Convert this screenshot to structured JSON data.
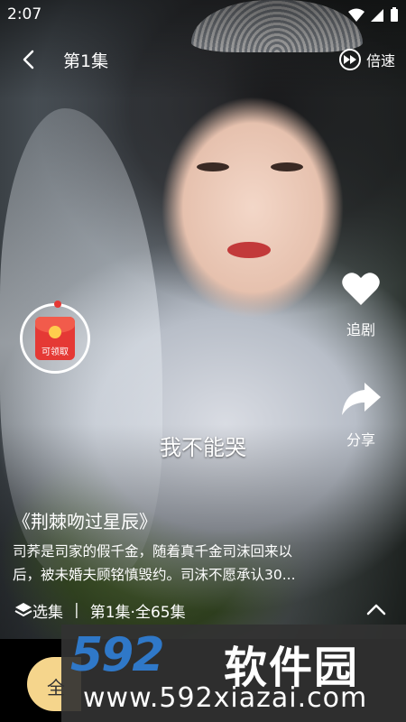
{
  "status_bar": {
    "time": "2:07"
  },
  "header": {
    "episode_title": "第1集",
    "speed_label": "倍速"
  },
  "red_packet": {
    "label": "可领取"
  },
  "actions": [
    {
      "label": "追剧",
      "icon": "heart-icon"
    },
    {
      "label": "分享",
      "icon": "share-icon"
    }
  ],
  "subtitle": "我不能哭",
  "drama": {
    "title": "《荆棘吻过星辰》",
    "description_line1": "司荞是司家的假千金，随着真千金司沫回来以",
    "description_line2": "后，被未婚夫顾铭慎毁约。司沫不愿承认30..."
  },
  "episode_bar": {
    "select_label": "选集",
    "progress_label": "第1集·全65集"
  },
  "bottom_bar": {
    "button_label": "全"
  },
  "watermark": {
    "logo_number": "592",
    "logo_text": "软件园",
    "url": "www.592xiazai.com"
  },
  "colors": {
    "accent_red": "#e53935",
    "watermark_blue": "#2f78c8",
    "button_gold": "#f5d58c"
  }
}
